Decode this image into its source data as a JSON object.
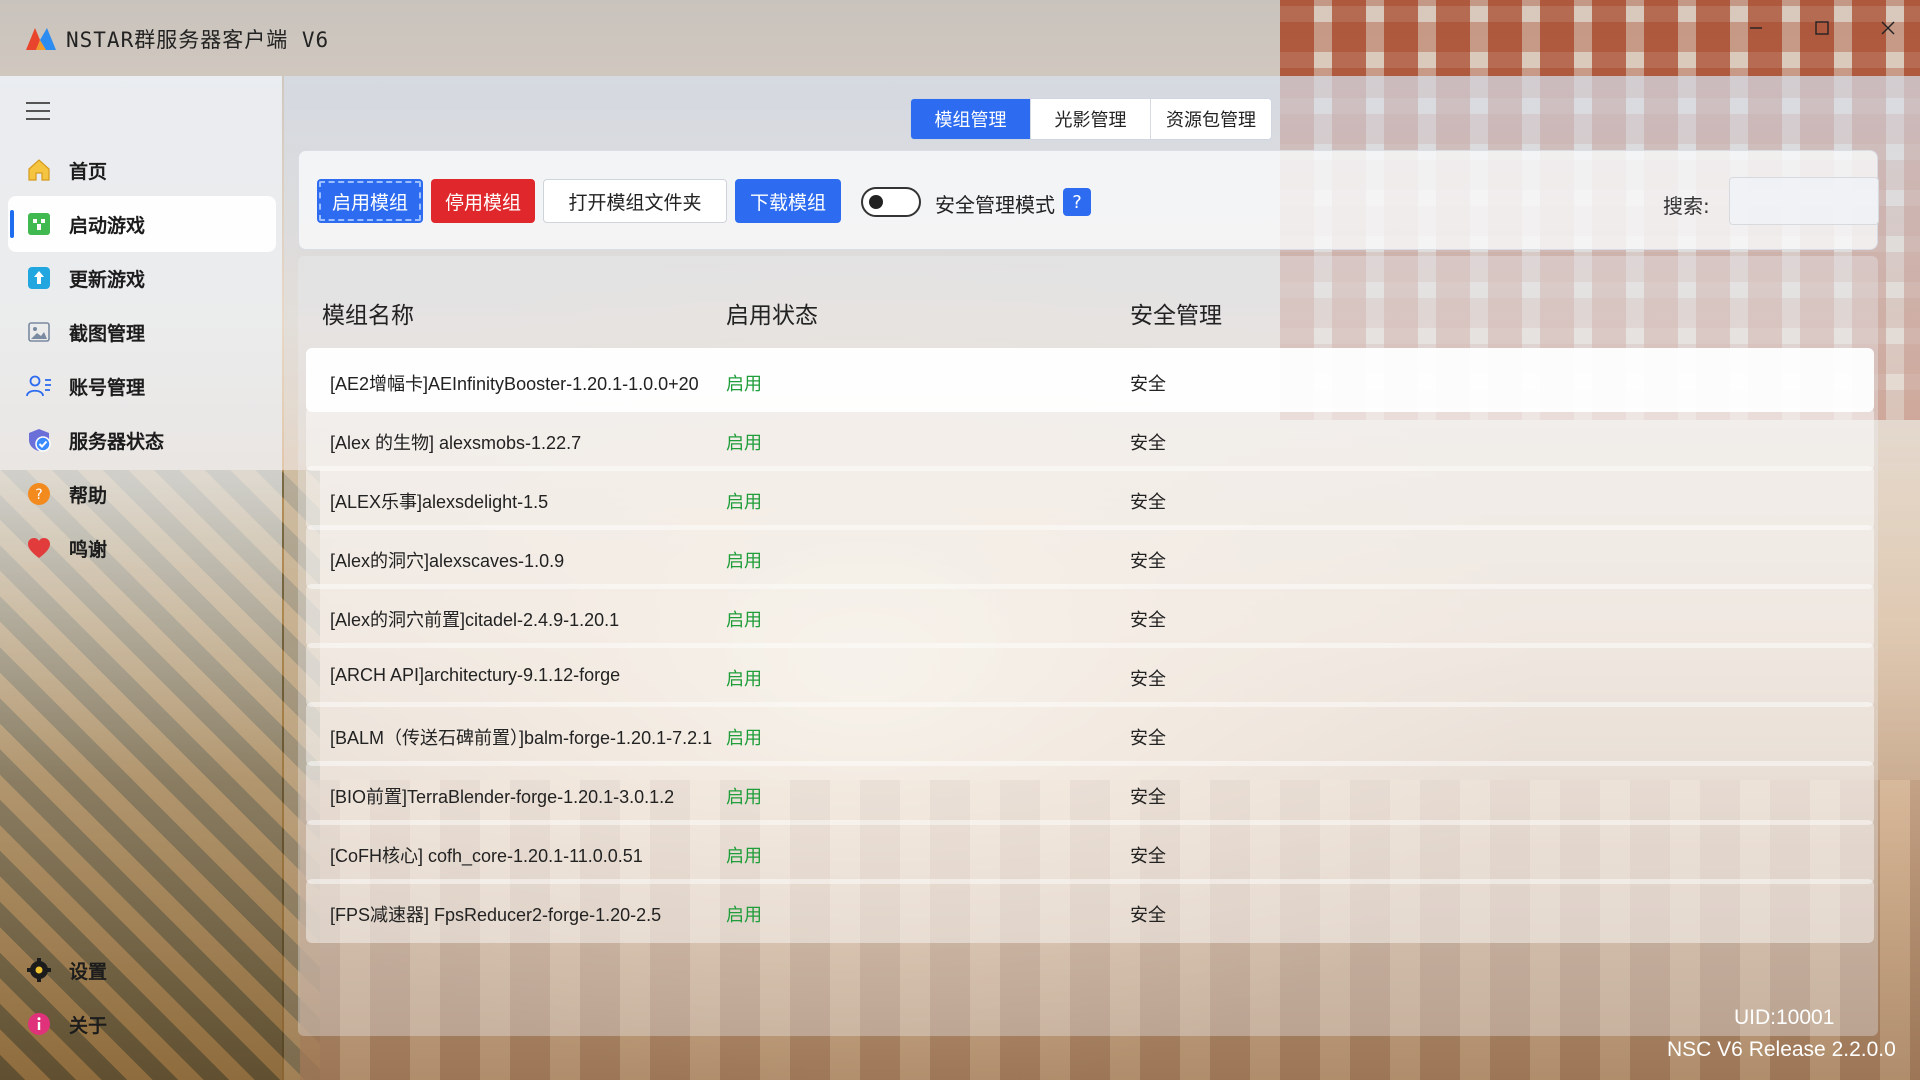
{
  "window": {
    "title": "NSTAR群服务器客户端 V6"
  },
  "sidebar": {
    "items": [
      {
        "label": "首页",
        "icon": "home-icon"
      },
      {
        "label": "启动游戏",
        "icon": "creeper-icon",
        "active": true
      },
      {
        "label": "更新游戏",
        "icon": "update-icon"
      },
      {
        "label": "截图管理",
        "icon": "image-icon"
      },
      {
        "label": "账号管理",
        "icon": "account-icon"
      },
      {
        "label": "服务器状态",
        "icon": "server-status-icon"
      },
      {
        "label": "帮助",
        "icon": "help-icon"
      },
      {
        "label": "鸣谢",
        "icon": "heart-icon"
      }
    ],
    "bottom": [
      {
        "label": "设置",
        "icon": "gear-icon"
      },
      {
        "label": "关于",
        "icon": "info-icon"
      }
    ]
  },
  "tabs": [
    {
      "label": "模组管理",
      "active": true
    },
    {
      "label": "光影管理"
    },
    {
      "label": "资源包管理"
    }
  ],
  "toolbar": {
    "enable_label": "启用模组",
    "disable_label": "停用模组",
    "open_folder_label": "打开模组文件夹",
    "download_label": "下载模组",
    "safe_mode_label": "安全管理模式",
    "safe_mode_on": false,
    "help_label": "?",
    "search_label": "搜索:",
    "search_value": ""
  },
  "table": {
    "columns": [
      "模组名称",
      "启用状态",
      "安全管理"
    ],
    "rows": [
      {
        "name": "[AE2增幅卡]AEInfinityBooster-1.20.1-1.0.0+20",
        "state": "启用",
        "safe": "安全"
      },
      {
        "name": "[Alex 的生物] alexsmobs-1.22.7",
        "state": "启用",
        "safe": "安全"
      },
      {
        "name": "[ALEX乐事]alexsdelight-1.5",
        "state": "启用",
        "safe": "安全"
      },
      {
        "name": "[Alex的洞穴]alexscaves-1.0.9",
        "state": "启用",
        "safe": "安全"
      },
      {
        "name": "[Alex的洞穴前置]citadel-2.4.9-1.20.1",
        "state": "启用",
        "safe": "安全"
      },
      {
        "name": "[ARCH API]architectury-9.1.12-forge",
        "state": "启用",
        "safe": "安全"
      },
      {
        "name": "[BALM（传送石碑前置）]balm-forge-1.20.1-7.2.1",
        "state": "启用",
        "safe": "安全"
      },
      {
        "name": "[BIO前置]TerraBlender-forge-1.20.1-3.0.1.2",
        "state": "启用",
        "safe": "安全"
      },
      {
        "name": "[CoFH核心] cofh_core-1.20.1-11.0.0.51",
        "state": "启用",
        "safe": "安全"
      },
      {
        "name": "[FPS减速器] FpsReducer2-forge-1.20-2.5",
        "state": "启用",
        "safe": "安全"
      }
    ]
  },
  "footer": {
    "uid": "UID:10001",
    "release": "NSC V6 Release 2.2.0.0"
  },
  "colors": {
    "accent": "#2d6cf0",
    "danger": "#e0272b",
    "enabled_text": "#1f9d3a"
  }
}
